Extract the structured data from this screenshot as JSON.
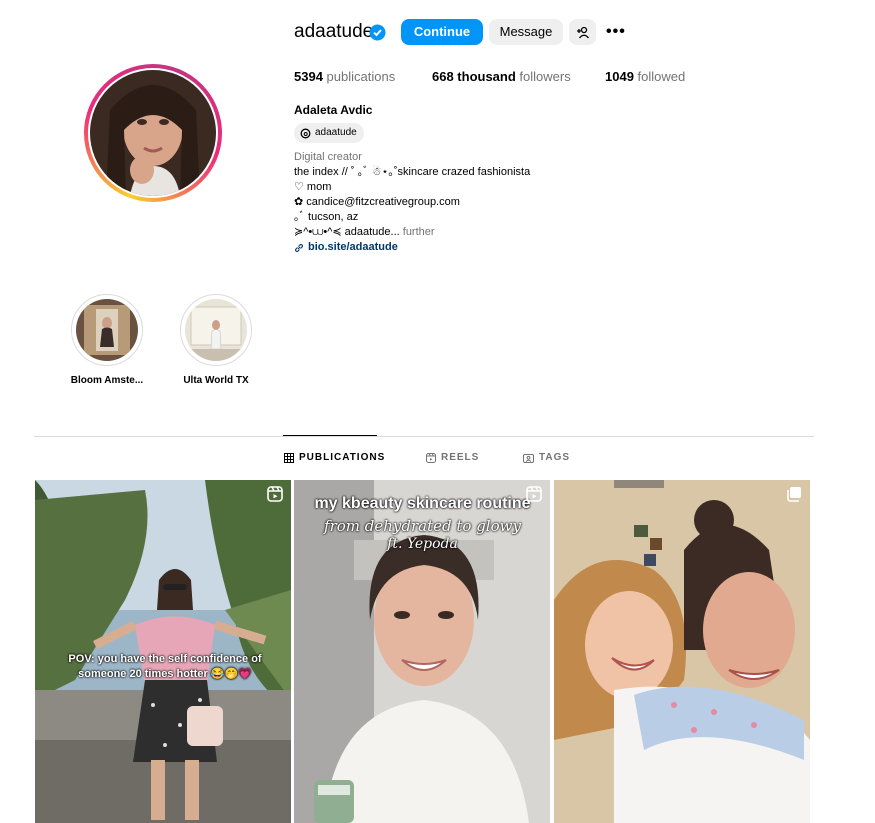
{
  "profile": {
    "username": "adaatude",
    "continue_label": "Continue",
    "message_label": "Message",
    "stats": {
      "publications_count": "5394",
      "publications_label": " publications",
      "followers_count": "668 thousand",
      "followers_label": " followers",
      "followed_count": "1049",
      "followed_label": " followed"
    },
    "full_name": "Adaleta Avdic",
    "threads_handle": "adaatude",
    "bio": {
      "category": "Digital creator",
      "line1": "the index // ˚ ｡ﾞ ☃︎⋆｡˚skincare crazed fashionista",
      "line2": "♡ mom",
      "line3": "✿ candice@fitzcreativegroup.com",
      "line4": "｡ﾞ tucson, az",
      "line5": "≽^•⩊•^≼ adaatude...",
      "more_label": " further",
      "link": "bio.site/adaatude"
    }
  },
  "highlights": [
    {
      "label": "Bloom Amste..."
    },
    {
      "label": "Ulta World TX"
    }
  ],
  "tabs": [
    {
      "label": "PUBLICATIONS",
      "icon": "grid-icon",
      "active": true
    },
    {
      "label": "REELS",
      "icon": "reels-icon",
      "active": false
    },
    {
      "label": "TAGS",
      "icon": "tag-icon",
      "active": false
    }
  ],
  "posts": [
    {
      "type": "reel",
      "overlay": "POV: you have the self confidence of someone 20 times hotter 😂🤭💗"
    },
    {
      "type": "reel",
      "overlay_title": "my kbeauty skincare routine",
      "overlay_sub1": "from dehydrated to glowy",
      "overlay_sub2": "ft. Yepoda"
    },
    {
      "type": "carousel"
    }
  ],
  "colors": {
    "accent": "#0095f6",
    "link": "#00376b",
    "muted": "#737373",
    "button_bg": "#efefef"
  }
}
